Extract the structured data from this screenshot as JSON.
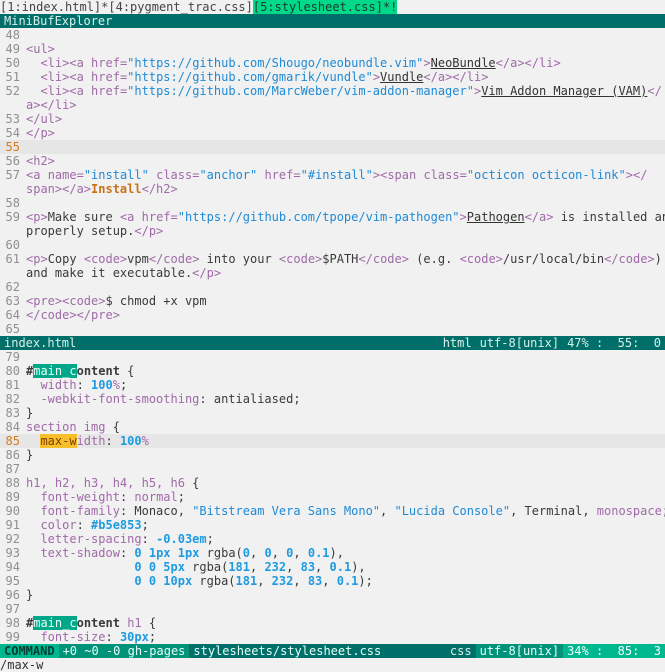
{
  "tabline": {
    "tabs": [
      {
        "label": "[1:index.html]*",
        "current": false
      },
      {
        "label": "[4:pygment_trac.css]",
        "current": false
      },
      {
        "label": "[5:stylesheet.css]*!",
        "current": true
      }
    ]
  },
  "minibuf": {
    "title": "MiniBufExplorer"
  },
  "top_pane": {
    "filename": "index.html",
    "filetype": "html",
    "encoding": "utf-8[unix]",
    "position": "47% :  55:  0",
    "lines": [
      {
        "n": "48",
        "segs": []
      },
      {
        "n": "49",
        "segs": [
          [
            "tag",
            "<ul>"
          ]
        ]
      },
      {
        "n": "50",
        "segs": [
          [
            "txt",
            "  "
          ],
          [
            "tag",
            "<li><a "
          ],
          [
            "attr",
            "href"
          ],
          [
            "tag",
            "="
          ],
          [
            "str",
            "\"https://github.com/Shougo/neobundle.vim\""
          ],
          [
            "tag",
            ">"
          ],
          [
            "link",
            "NeoBundle"
          ],
          [
            "tag",
            "</a></li>"
          ]
        ]
      },
      {
        "n": "51",
        "segs": [
          [
            "txt",
            "  "
          ],
          [
            "tag",
            "<li><a "
          ],
          [
            "attr",
            "href"
          ],
          [
            "tag",
            "="
          ],
          [
            "str",
            "\"https://github.com/gmarik/vundle\""
          ],
          [
            "tag",
            ">"
          ],
          [
            "link",
            "Vundle"
          ],
          [
            "tag",
            "</a></li>"
          ]
        ]
      },
      {
        "n": "52",
        "segs": [
          [
            "txt",
            "  "
          ],
          [
            "tag",
            "<li><a "
          ],
          [
            "attr",
            "href"
          ],
          [
            "tag",
            "="
          ],
          [
            "str",
            "\"https://github.com/MarcWeber/vim-addon-manager\""
          ],
          [
            "tag",
            ">"
          ],
          [
            "link",
            "Vim Addon Manager (VAM)"
          ],
          [
            "tag",
            "</"
          ]
        ]
      },
      {
        "n": "",
        "segs": [
          [
            "tag",
            "a></li>"
          ]
        ]
      },
      {
        "n": "53",
        "segs": [
          [
            "tag",
            "</ul>"
          ]
        ]
      },
      {
        "n": "54",
        "segs": [
          [
            "tag",
            "</p>"
          ]
        ]
      },
      {
        "n": "55",
        "cursor": true,
        "segs": []
      },
      {
        "n": "56",
        "segs": [
          [
            "tag",
            "<h2>"
          ]
        ]
      },
      {
        "n": "57",
        "segs": [
          [
            "tag",
            "<a "
          ],
          [
            "attr",
            "name"
          ],
          [
            "tag",
            "="
          ],
          [
            "str",
            "\"install\""
          ],
          [
            "tag",
            " "
          ],
          [
            "attr",
            "class"
          ],
          [
            "tag",
            "="
          ],
          [
            "str",
            "\"anchor\""
          ],
          [
            "tag",
            " "
          ],
          [
            "attr",
            "href"
          ],
          [
            "tag",
            "="
          ],
          [
            "str",
            "\"#install\""
          ],
          [
            "tag",
            "><span "
          ],
          [
            "attr",
            "class"
          ],
          [
            "tag",
            "="
          ],
          [
            "str",
            "\"octicon octicon-link\""
          ],
          [
            "tag",
            "></"
          ]
        ]
      },
      {
        "n": "",
        "segs": [
          [
            "tag",
            "span></a>"
          ],
          [
            "bold-orange",
            "Install"
          ],
          [
            "tag",
            "</h2>"
          ]
        ]
      },
      {
        "n": "58",
        "segs": []
      },
      {
        "n": "59",
        "segs": [
          [
            "tag",
            "<p>"
          ],
          [
            "txt",
            "Make sure "
          ],
          [
            "tag",
            "<a "
          ],
          [
            "attr",
            "href"
          ],
          [
            "tag",
            "="
          ],
          [
            "str",
            "\"https://github.com/tpope/vim-pathogen\""
          ],
          [
            "tag",
            ">"
          ],
          [
            "link",
            "Pathogen"
          ],
          [
            "tag",
            "</a>"
          ],
          [
            "txt",
            " is installed and"
          ]
        ]
      },
      {
        "n": "",
        "segs": [
          [
            "txt",
            "properly setup."
          ],
          [
            "tag",
            "</p>"
          ]
        ]
      },
      {
        "n": "60",
        "segs": []
      },
      {
        "n": "61",
        "segs": [
          [
            "tag",
            "<p>"
          ],
          [
            "txt",
            "Copy "
          ],
          [
            "tag",
            "<code>"
          ],
          [
            "txt",
            "vpm"
          ],
          [
            "tag",
            "</code>"
          ],
          [
            "txt",
            " into your "
          ],
          [
            "tag",
            "<code>"
          ],
          [
            "txt",
            "$PATH"
          ],
          [
            "tag",
            "</code>"
          ],
          [
            "txt",
            " (e.g. "
          ],
          [
            "tag",
            "<code>"
          ],
          [
            "txt",
            "/usr/local/bin"
          ],
          [
            "tag",
            "</code>"
          ],
          [
            "txt",
            ")"
          ]
        ]
      },
      {
        "n": "",
        "segs": [
          [
            "txt",
            "and make it executable."
          ],
          [
            "tag",
            "</p>"
          ]
        ]
      },
      {
        "n": "62",
        "segs": []
      },
      {
        "n": "63",
        "segs": [
          [
            "tag",
            "<pre><code>"
          ],
          [
            "txt",
            "$ chmod +x vpm"
          ]
        ]
      },
      {
        "n": "64",
        "segs": [
          [
            "tag",
            "</code></pre>"
          ]
        ]
      },
      {
        "n": "65",
        "segs": []
      }
    ]
  },
  "bottom_pane": {
    "mode": "COMMAND",
    "git": "+0 ~0 -0 gh-pages",
    "filename": "stylesheets/stylesheet.css",
    "filetype": "css",
    "encoding": "utf-8[unix]",
    "position": "34% :  85:  3",
    "lines": [
      {
        "n": "79",
        "segs": []
      },
      {
        "n": "80",
        "segs": [
          [
            "sel",
            "#"
          ],
          [
            "search-hl",
            "main_c"
          ],
          [
            "sel",
            "ontent"
          ],
          [
            "punct",
            " {"
          ]
        ]
      },
      {
        "n": "81",
        "segs": [
          [
            "txt",
            "  "
          ],
          [
            "prop",
            "width"
          ],
          [
            "punct",
            ": "
          ],
          [
            "num",
            "100"
          ],
          [
            "prop",
            "%"
          ],
          [
            "punct",
            ";"
          ]
        ]
      },
      {
        "n": "82",
        "segs": [
          [
            "txt",
            "  "
          ],
          [
            "prop",
            "-webkit-font-smoothing"
          ],
          [
            "punct",
            ": antialiased;"
          ]
        ]
      },
      {
        "n": "83",
        "segs": [
          [
            "punct",
            "}"
          ]
        ]
      },
      {
        "n": "84",
        "segs": [
          [
            "kw",
            "section img"
          ],
          [
            "punct",
            " {"
          ]
        ]
      },
      {
        "n": "85",
        "cursor": true,
        "segs": [
          [
            "txt",
            "  "
          ],
          [
            "inc-hl",
            "max-w"
          ],
          [
            "prop",
            "idth"
          ],
          [
            "punct",
            ": "
          ],
          [
            "num",
            "100"
          ],
          [
            "prop",
            "%"
          ]
        ]
      },
      {
        "n": "86",
        "segs": [
          [
            "punct",
            "}"
          ]
        ]
      },
      {
        "n": "87",
        "segs": []
      },
      {
        "n": "88",
        "segs": [
          [
            "kw",
            "h1, h2, h3, h4, h5, h6"
          ],
          [
            "punct",
            " {"
          ]
        ]
      },
      {
        "n": "89",
        "segs": [
          [
            "txt",
            "  "
          ],
          [
            "prop",
            "font-weight"
          ],
          [
            "punct",
            ": "
          ],
          [
            "prop",
            "normal"
          ],
          [
            "punct",
            ";"
          ]
        ]
      },
      {
        "n": "90",
        "segs": [
          [
            "txt",
            "  "
          ],
          [
            "prop",
            "font-family"
          ],
          [
            "punct",
            ": Monaco, "
          ],
          [
            "str",
            "\"Bitstream Vera Sans Mono\""
          ],
          [
            "punct",
            ", "
          ],
          [
            "str",
            "\"Lucida Console\""
          ],
          [
            "punct",
            ", Terminal, "
          ],
          [
            "prop",
            "monospace"
          ],
          [
            "punct",
            ";"
          ]
        ]
      },
      {
        "n": "91",
        "segs": [
          [
            "txt",
            "  "
          ],
          [
            "prop",
            "color"
          ],
          [
            "punct",
            ": "
          ],
          [
            "num",
            "#b5e853"
          ],
          [
            "punct",
            ";"
          ]
        ]
      },
      {
        "n": "92",
        "segs": [
          [
            "txt",
            "  "
          ],
          [
            "prop",
            "letter-spacing"
          ],
          [
            "punct",
            ": "
          ],
          [
            "num",
            "-0.03em"
          ],
          [
            "punct",
            ";"
          ]
        ]
      },
      {
        "n": "93",
        "segs": [
          [
            "txt",
            "  "
          ],
          [
            "prop",
            "text-shadow"
          ],
          [
            "punct",
            ": "
          ],
          [
            "num",
            "0 1px 1px"
          ],
          [
            "punct",
            " rgba("
          ],
          [
            "num",
            "0"
          ],
          [
            "punct",
            ", "
          ],
          [
            "num",
            "0"
          ],
          [
            "punct",
            ", "
          ],
          [
            "num",
            "0"
          ],
          [
            "punct",
            ", "
          ],
          [
            "num",
            "0.1"
          ],
          [
            "punct",
            "),"
          ]
        ]
      },
      {
        "n": "94",
        "segs": [
          [
            "txt",
            "               "
          ],
          [
            "num",
            "0 0 5px"
          ],
          [
            "punct",
            " rgba("
          ],
          [
            "num",
            "181"
          ],
          [
            "punct",
            ", "
          ],
          [
            "num",
            "232"
          ],
          [
            "punct",
            ", "
          ],
          [
            "num",
            "83"
          ],
          [
            "punct",
            ", "
          ],
          [
            "num",
            "0.1"
          ],
          [
            "punct",
            "),"
          ]
        ]
      },
      {
        "n": "95",
        "segs": [
          [
            "txt",
            "               "
          ],
          [
            "num",
            "0 0 10px"
          ],
          [
            "punct",
            " rgba("
          ],
          [
            "num",
            "181"
          ],
          [
            "punct",
            ", "
          ],
          [
            "num",
            "232"
          ],
          [
            "punct",
            ", "
          ],
          [
            "num",
            "83"
          ],
          [
            "punct",
            ", "
          ],
          [
            "num",
            "0.1"
          ],
          [
            "punct",
            ");"
          ]
        ]
      },
      {
        "n": "96",
        "segs": [
          [
            "punct",
            "}"
          ]
        ]
      },
      {
        "n": "97",
        "segs": []
      },
      {
        "n": "98",
        "segs": [
          [
            "sel",
            "#"
          ],
          [
            "search-hl",
            "main_c"
          ],
          [
            "sel",
            "ontent"
          ],
          [
            "punct",
            " "
          ],
          [
            "kw",
            "h1"
          ],
          [
            "punct",
            " {"
          ]
        ]
      },
      {
        "n": "99",
        "segs": [
          [
            "txt",
            "  "
          ],
          [
            "prop",
            "font-size"
          ],
          [
            "punct",
            ": "
          ],
          [
            "num",
            "30px"
          ],
          [
            "punct",
            ";"
          ]
        ]
      }
    ]
  },
  "cmdline": {
    "text": "/max-w"
  }
}
